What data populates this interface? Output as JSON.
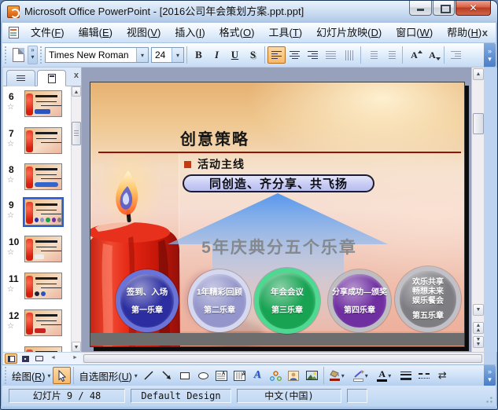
{
  "window": {
    "title": "Microsoft Office PowerPoint - [2016公司年会策划方案.ppt.ppt]"
  },
  "icons": {
    "chevron_double": "»",
    "dropdown": "▾",
    "close_x": "✕",
    "menu_close_x": "x",
    "up_arrow": "▲",
    "down_arrow": "▼",
    "left_arrow": "◄",
    "right_arrow": "►",
    "star": "☆",
    "arrow_swap": "⇄",
    "wordart_a": "A",
    "font_color_a": "A",
    "size_a": "A"
  },
  "menubar": {
    "items": [
      "文件(F)",
      "编辑(E)",
      "视图(V)",
      "插入(I)",
      "格式(O)",
      "工具(T)",
      "幻灯片放映(D)",
      "窗口(W)",
      "帮助(H)"
    ]
  },
  "toolbar": {
    "font_name": "Times New Roman",
    "font_size": "24",
    "bold": "B",
    "italic": "I",
    "underline": "U",
    "shadow": "S"
  },
  "sidebar": {
    "thumbs": [
      {
        "num": "6"
      },
      {
        "num": "7"
      },
      {
        "num": "8"
      },
      {
        "num": "9",
        "selected": true
      },
      {
        "num": "10"
      },
      {
        "num": "11"
      },
      {
        "num": "12"
      }
    ]
  },
  "slide": {
    "title": "创意策略",
    "bullet_text": "活动主线",
    "pill_text": "同创造、齐分享、共飞扬",
    "arrow_text": "5年庆典分五个乐章",
    "arrow_color": "#7ba6e8",
    "circles": [
      {
        "lines": [
          "签到、入场"
        ],
        "chapter": "第一乐章",
        "fill": "#2b2da0",
        "ring": "#6a74d8"
      },
      {
        "lines": [
          "1年精彩回顾"
        ],
        "chapter": "第二乐章",
        "fill": "#9496cb",
        "ring": "#d6d8f0"
      },
      {
        "lines": [
          "年会会议"
        ],
        "chapter": "第三乐章",
        "fill": "#17a352",
        "ring": "#4fd892"
      },
      {
        "lines": [
          "分享成功—颁奖"
        ],
        "chapter": "第四乐章",
        "fill": "#6f2fa0",
        "ring": "#bdbdc2"
      },
      {
        "lines": [
          "欢乐共享",
          "畅想未来",
          "娱乐餐会"
        ],
        "chapter": "第五乐章",
        "fill": "#7d7d82",
        "ring": "#c0c0c6"
      }
    ]
  },
  "drawbar": {
    "draw": "绘图(R)",
    "autoshapes": "自选图形(U)"
  },
  "statusbar": {
    "slide_info": "幻灯片 9 / 48",
    "design_name": "Default Design",
    "language": "中文(中国)"
  }
}
